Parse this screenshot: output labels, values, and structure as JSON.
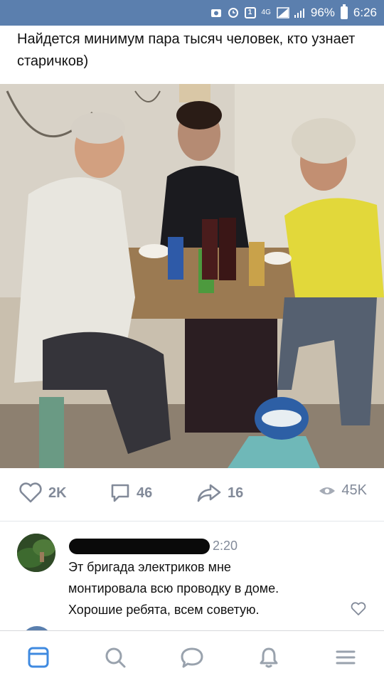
{
  "status_bar": {
    "network": "4G",
    "battery": "96%",
    "time": "6:26",
    "icons": [
      "photo-icon",
      "alarm-icon",
      "sim-icon",
      "network-icon",
      "signal-icon",
      "battery-icon"
    ]
  },
  "post": {
    "text": "Найдется минимум пара тысяч человек, кто узнает старичков)"
  },
  "actions": {
    "likes": "2K",
    "comments": "46",
    "shares": "16",
    "views": "45K"
  },
  "comment": {
    "time": "2:20",
    "text_lines": [
      "Эт бригада электриков мне",
      "монтировала всю проводку в доме.",
      "Хорошие ребята, всем советую."
    ]
  },
  "nav": {
    "items": [
      "news-icon",
      "search-icon",
      "messages-icon",
      "notifications-icon",
      "menu-icon"
    ]
  },
  "colors": {
    "status_bar": "#5b7fae",
    "accent": "#3f8ae0",
    "muted": "#828a99"
  }
}
